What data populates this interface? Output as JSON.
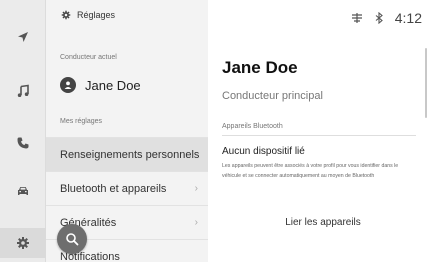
{
  "header": {
    "title": "Réglages",
    "time": "4:12"
  },
  "rail": {
    "icons": [
      "navigation-icon",
      "music-icon",
      "phone-icon",
      "car-icon",
      "settings-icon"
    ]
  },
  "list": {
    "current_driver_label": "Conducteur actuel",
    "current_driver_name": "Jane Doe",
    "my_settings_label": "Mes réglages",
    "items": [
      {
        "label": "Renseignements personnels"
      },
      {
        "label": "Bluetooth et appareils"
      },
      {
        "label": "Généralités"
      },
      {
        "label": "Notifications"
      }
    ]
  },
  "detail": {
    "name": "Jane Doe",
    "role": "Conducteur principal",
    "section": "Appareils Bluetooth",
    "no_device_title": "Aucun dispositif lié",
    "no_device_desc": "Les appareils peuvent être associés à votre profil pour vous identifier dans le véhicule et se connecter automatiquement au moyen de Bluetooth",
    "pair_button": "Lier les appareils"
  },
  "colors": {
    "rail_bg": "#ebebeb",
    "list_bg": "#f3f3f3",
    "selected_bg": "#e0e0e0",
    "search_btn": "#6e6e6e"
  }
}
